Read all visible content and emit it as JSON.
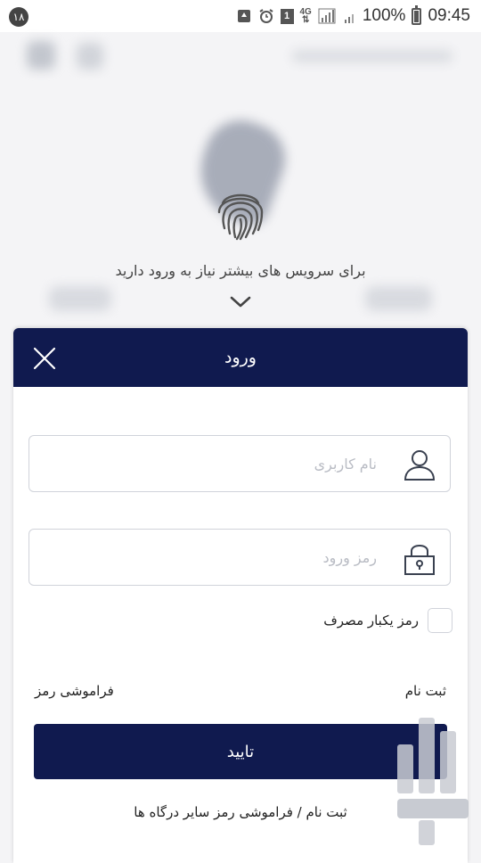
{
  "status_bar": {
    "notification_count": "۱۸",
    "network": "4G",
    "sim": "1",
    "battery": "100%",
    "time": "09:45",
    "icons": [
      "recycle-icon",
      "alarm-icon",
      "sim-icon",
      "signal-icon",
      "battery-icon"
    ]
  },
  "background": {
    "login_hint": "برای سرویس های بیشتر نیاز به ورود دارید",
    "icons": [
      "fingerprint-icon",
      "chevron-down-icon"
    ]
  },
  "login_sheet": {
    "title": "ورود",
    "username_placeholder": "نام کاربری",
    "password_placeholder": "رمز ورود",
    "otp_label": "رمز یکبار مصرف",
    "register_link": "ثبت نام",
    "forgot_link": "فراموشی رمز",
    "submit_label": "تایید",
    "other_portals_link": "ثبت نام / فراموشی رمز سایر درگاه ها"
  },
  "colors": {
    "primary": "#101a4f",
    "field_border": "#d0d3da",
    "placeholder": "#b9bcc4"
  }
}
